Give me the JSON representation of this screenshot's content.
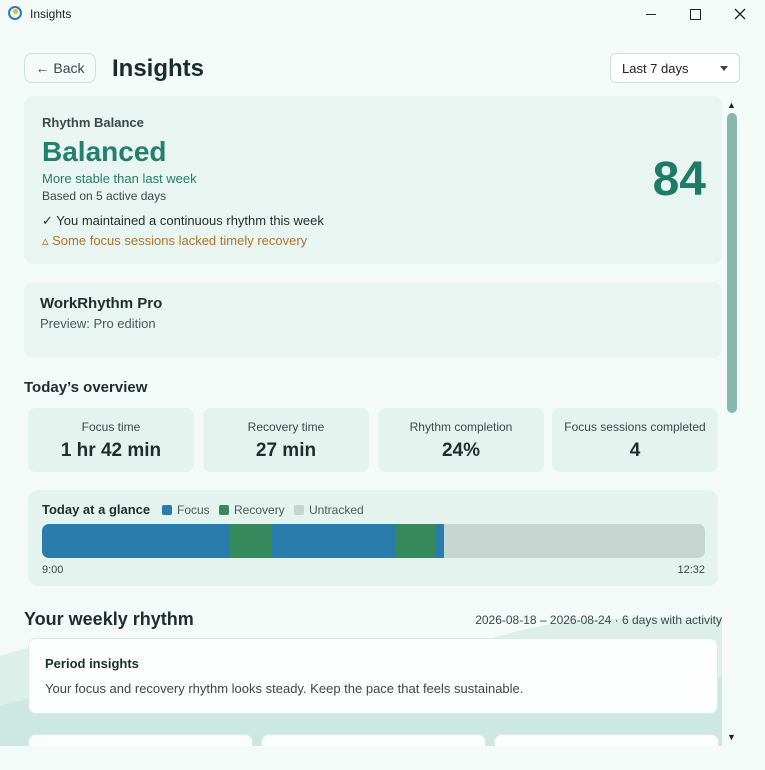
{
  "window": {
    "title": "Insights"
  },
  "header": {
    "back_label": "← Back",
    "title": "Insights",
    "range_value": "Last 7 days"
  },
  "rhythm_balance": {
    "label": "Rhythm Balance",
    "status": "Balanced",
    "comparison": "More stable than last week",
    "basis": "Based on 5 active days",
    "positive_note": "✓ You maintained a continuous rhythm this week",
    "warning_note": "▵ Some focus sessions lacked timely recovery",
    "score": "84"
  },
  "pro": {
    "title": "WorkRhythm Pro",
    "subtitle": "Preview: Pro edition"
  },
  "overview": {
    "title": "Today’s overview",
    "stats": [
      {
        "label": "Focus time",
        "value": "1 hr 42 min"
      },
      {
        "label": "Recovery time",
        "value": "27 min"
      },
      {
        "label": "Rhythm completion",
        "value": "24%"
      },
      {
        "label": "Focus sessions completed",
        "value": "4"
      }
    ]
  },
  "glance": {
    "title": "Today at a glance",
    "legend": [
      {
        "label": "Focus",
        "color": "#2a7cad"
      },
      {
        "label": "Recovery",
        "color": "#37885a"
      },
      {
        "label": "Untracked",
        "color": "#c5d5d0"
      }
    ],
    "segments": [
      {
        "type": "Focus",
        "fraction": 0.283
      },
      {
        "type": "Recovery",
        "fraction": 0.064
      },
      {
        "type": "Focus",
        "fraction": 0.185
      },
      {
        "type": "Recovery",
        "fraction": 0.062
      },
      {
        "type": "Focus",
        "fraction": 0.013
      },
      {
        "type": "Untracked",
        "fraction": 0.393
      }
    ],
    "start_time": "9:00",
    "end_time": "12:32"
  },
  "weekly": {
    "title": "Your weekly rhythm",
    "range_text": "2026-08-18 – 2026-08-24 · 6 days with activity",
    "period_title": "Period insights",
    "period_text": "Your focus and recovery rhythm looks steady. Keep the pace that feels sustainable."
  },
  "colors": {
    "accent": "#23806d",
    "focus": "#2a7cad",
    "recovery": "#37885a",
    "untracked": "#c5d5d0",
    "warning": "#b3722a"
  }
}
